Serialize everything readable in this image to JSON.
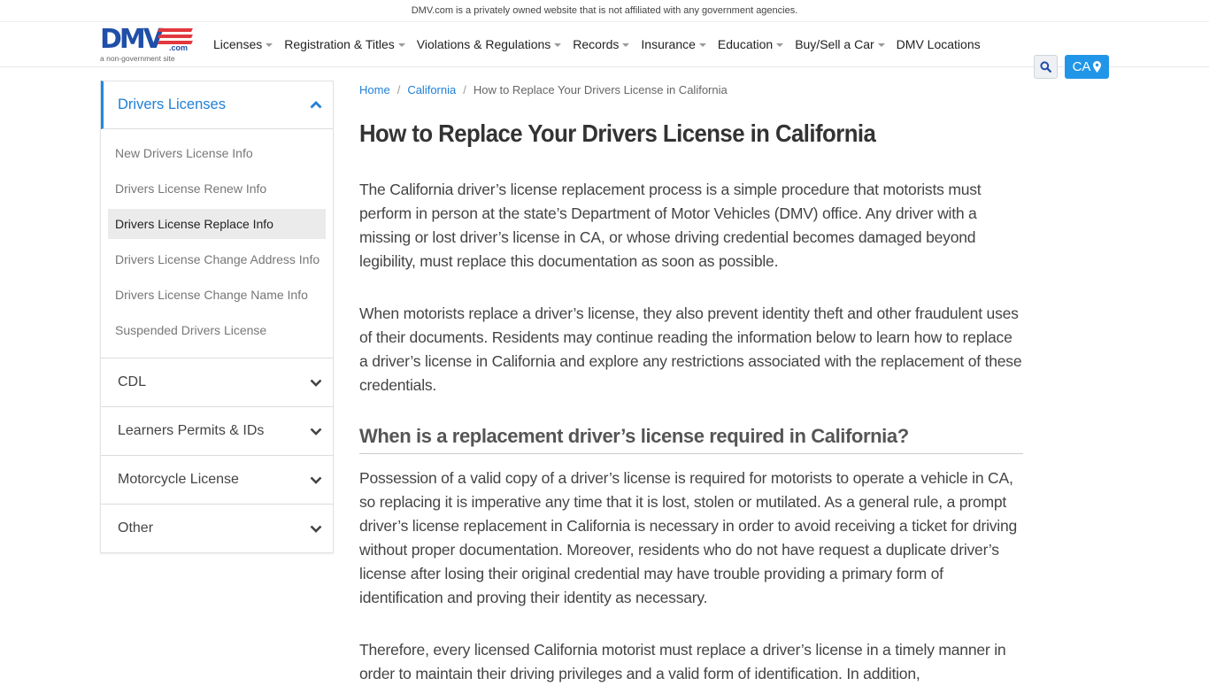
{
  "topbar": {
    "disclaimer": "DMV.com is a privately owned website that is not affiliated with any government agencies."
  },
  "logo": {
    "text": "DMV",
    "suffix": ".com",
    "tagline": "a non-government site"
  },
  "nav": {
    "items": [
      {
        "label": "Licenses",
        "dropdown": true
      },
      {
        "label": "Registration & Titles",
        "dropdown": true
      },
      {
        "label": "Violations & Regulations",
        "dropdown": true
      },
      {
        "label": "Records",
        "dropdown": true
      },
      {
        "label": "Insurance",
        "dropdown": true
      },
      {
        "label": "Education",
        "dropdown": true
      },
      {
        "label": "Buy/Sell a Car",
        "dropdown": true
      },
      {
        "label": "DMV Locations",
        "dropdown": false
      }
    ],
    "search_icon": "search-icon",
    "state_label": "CA",
    "state_icon": "map-marker-icon"
  },
  "sidebar": {
    "open_section": {
      "label": "Drivers Licenses",
      "icon": "chevron-up-icon"
    },
    "links": [
      {
        "label": "New Drivers License Info",
        "active": false
      },
      {
        "label": "Drivers License Renew Info",
        "active": false
      },
      {
        "label": "Drivers License Replace Info",
        "active": true
      },
      {
        "label": "Drivers License Change Address Info",
        "active": false
      },
      {
        "label": "Drivers License Change Name Info",
        "active": false
      },
      {
        "label": "Suspended Drivers License",
        "active": false
      }
    ],
    "categories": [
      {
        "label": "CDL",
        "icon": "chevron-down-icon"
      },
      {
        "label": "Learners Permits & IDs",
        "icon": "chevron-down-icon"
      },
      {
        "label": "Motorcycle License",
        "icon": "chevron-down-icon"
      },
      {
        "label": "Other",
        "icon": "chevron-down-icon"
      }
    ]
  },
  "breadcrumb": {
    "home": "Home",
    "state": "California",
    "current": "How to Replace Your Drivers License in California",
    "separator": "/"
  },
  "article": {
    "title": "How to Replace Your Drivers License in California",
    "p1": "The California driver’s license replacement process is a simple procedure that motorists must perform in person at the state’s Department of Motor Vehicles (DMV) office. Any driver with a missing or lost driver’s license in CA, or whose driving credential becomes damaged beyond legibility, must replace this documentation as soon as possible.",
    "p2": "When motorists replace a driver’s license, they also prevent identity theft and other fraudulent uses of their documents. Residents may continue reading the information below to learn how to replace a driver’s license in California and explore any restrictions associated with the replacement of these credentials.",
    "h2": "When is a replacement driver’s license required in California?",
    "p3": "Possession of a valid copy of a driver’s license is required for motorists to operate a vehicle in CA, so replacing it is imperative any time that it is lost, stolen or mutilated. As a general rule, a prompt driver’s license replacement in California is necessary in order to avoid receiving a ticket for driving without proper documentation. Moreover, residents who do not have request a duplicate driver’s license after losing their original credential may have trouble providing a primary form of identification and proving their identity as necessary.",
    "p4": "Therefore, every licensed California motorist must replace a driver’s license in a timely manner in order to maintain their driving privileges and a valid form of identification. In addition,"
  }
}
